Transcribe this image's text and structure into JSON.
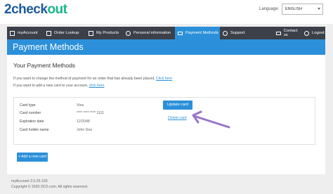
{
  "header": {
    "logo_main": "2check",
    "logo_accent": "out",
    "language_label": "Language:",
    "language_value": "ENGLISH"
  },
  "nav": {
    "items": [
      {
        "label": "myAccount",
        "icon": "account-icon"
      },
      {
        "label": "Order Lookup",
        "icon": "order-icon"
      },
      {
        "label": "My Products",
        "icon": "products-icon"
      },
      {
        "label": "Personal information",
        "icon": "user-icon"
      },
      {
        "label": "Payment Methods",
        "icon": "card-icon"
      },
      {
        "label": "Support",
        "icon": "support-icon"
      },
      {
        "label": "Contact us",
        "icon": "mail-icon"
      },
      {
        "label": "Logout",
        "icon": "power-icon"
      }
    ],
    "active_index": 4,
    "colors": {
      "bar": "#3b4049",
      "active": "#2b90d9"
    }
  },
  "page": {
    "title": "Payment Methods",
    "section_title": "Your Payment Methods",
    "change_text": "If you want to change the method of payment for an order that has already been placed,",
    "change_link": "Click here",
    "add_text": "If you want to add a new card to your account,",
    "add_link": "click here"
  },
  "card": {
    "fields": [
      {
        "label": "Card type",
        "value": "Visa"
      },
      {
        "label": "Card number",
        "value": "**** **** **** 1111"
      },
      {
        "label": "Expiration date",
        "value": "12/2048"
      },
      {
        "label": "Card holder name",
        "value": "John Doe"
      }
    ],
    "update_button": "Update card",
    "delete_link": "Delete card",
    "add_button": "+ Add a new card"
  },
  "footer": {
    "version": "myAccount 2.0.25.193",
    "copyright": "Copyright © 2020 2CO.com. All rights reserved."
  }
}
